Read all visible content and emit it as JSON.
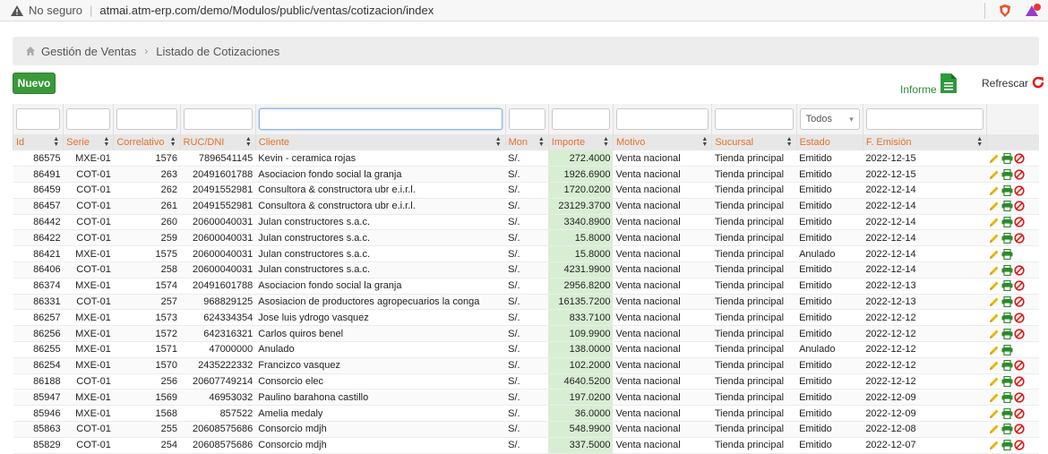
{
  "browser": {
    "security_label": "No seguro",
    "url": "atmai.atm-erp.com/demo/Modulos/public/ventas/cotizacion/index"
  },
  "breadcrumb": {
    "items": [
      "Gestión de Ventas",
      "Listado de Cotizaciones"
    ]
  },
  "toolbar": {
    "new_label": "Nuevo",
    "report_label": "Informe",
    "refresh_label": "Refrescar"
  },
  "filters": {
    "estado_selected": "Todos"
  },
  "columns": [
    "Id",
    "Serie",
    "Correlativo",
    "RUC/DNI",
    "Cliente",
    "Mon",
    "Importe",
    "Motivo",
    "Sucursal",
    "Estado",
    "F. Emisión"
  ],
  "rows": [
    {
      "id": "86575",
      "serie": "MXE-01",
      "correlativo": "1576",
      "ruc": "7896541145",
      "cliente": "Kevin - ceramica rojas",
      "mon": "S/.",
      "importe": "272.4000",
      "motivo": "Venta nacional",
      "sucursal": "Tienda principal",
      "estado": "Emitido",
      "fecha": "2022-12-15",
      "cancel": true
    },
    {
      "id": "86491",
      "serie": "COT-01",
      "correlativo": "263",
      "ruc": "20491601788",
      "cliente": "Asociacion fondo social la granja",
      "mon": "S/.",
      "importe": "1926.6900",
      "motivo": "Venta nacional",
      "sucursal": "Tienda principal",
      "estado": "Emitido",
      "fecha": "2022-12-15",
      "cancel": true
    },
    {
      "id": "86459",
      "serie": "COT-01",
      "correlativo": "262",
      "ruc": "20491552981",
      "cliente": "Consultora & constructora ubr e.i.r.l.",
      "mon": "S/.",
      "importe": "1720.0200",
      "motivo": "Venta nacional",
      "sucursal": "Tienda principal",
      "estado": "Emitido",
      "fecha": "2022-12-14",
      "cancel": true
    },
    {
      "id": "86457",
      "serie": "COT-01",
      "correlativo": "261",
      "ruc": "20491552981",
      "cliente": "Consultora & constructora ubr e.i.r.l.",
      "mon": "S/.",
      "importe": "23129.3700",
      "motivo": "Venta nacional",
      "sucursal": "Tienda principal",
      "estado": "Emitido",
      "fecha": "2022-12-14",
      "cancel": true
    },
    {
      "id": "86442",
      "serie": "COT-01",
      "correlativo": "260",
      "ruc": "20600040031",
      "cliente": "Julan constructores s.a.c.",
      "mon": "S/.",
      "importe": "3340.8900",
      "motivo": "Venta nacional",
      "sucursal": "Tienda principal",
      "estado": "Emitido",
      "fecha": "2022-12-14",
      "cancel": true
    },
    {
      "id": "86422",
      "serie": "COT-01",
      "correlativo": "259",
      "ruc": "20600040031",
      "cliente": "Julan constructores s.a.c.",
      "mon": "S/.",
      "importe": "15.8000",
      "motivo": "Venta nacional",
      "sucursal": "Tienda principal",
      "estado": "Emitido",
      "fecha": "2022-12-14",
      "cancel": true
    },
    {
      "id": "86421",
      "serie": "MXE-01",
      "correlativo": "1575",
      "ruc": "20600040031",
      "cliente": "Julan constructores s.a.c.",
      "mon": "S/.",
      "importe": "15.8000",
      "motivo": "Venta nacional",
      "sucursal": "Tienda principal",
      "estado": "Anulado",
      "fecha": "2022-12-14",
      "cancel": false
    },
    {
      "id": "86406",
      "serie": "COT-01",
      "correlativo": "258",
      "ruc": "20600040031",
      "cliente": "Julan constructores s.a.c.",
      "mon": "S/.",
      "importe": "4231.9900",
      "motivo": "Venta nacional",
      "sucursal": "Tienda principal",
      "estado": "Emitido",
      "fecha": "2022-12-14",
      "cancel": true
    },
    {
      "id": "86374",
      "serie": "MXE-01",
      "correlativo": "1574",
      "ruc": "20491601788",
      "cliente": "Asociacion fondo social la granja",
      "mon": "S/.",
      "importe": "2956.8200",
      "motivo": "Venta nacional",
      "sucursal": "Tienda principal",
      "estado": "Emitido",
      "fecha": "2022-12-13",
      "cancel": true
    },
    {
      "id": "86331",
      "serie": "COT-01",
      "correlativo": "257",
      "ruc": "968829125",
      "cliente": "Asosiacion de productores agropecuarios la conga",
      "mon": "S/.",
      "importe": "16135.7200",
      "motivo": "Venta nacional",
      "sucursal": "Tienda principal",
      "estado": "Emitido",
      "fecha": "2022-12-13",
      "cancel": true
    },
    {
      "id": "86257",
      "serie": "MXE-01",
      "correlativo": "1573",
      "ruc": "624334354",
      "cliente": "Jose luis ydrogo vasquez",
      "mon": "S/.",
      "importe": "833.7100",
      "motivo": "Venta nacional",
      "sucursal": "Tienda principal",
      "estado": "Emitido",
      "fecha": "2022-12-12",
      "cancel": true
    },
    {
      "id": "86256",
      "serie": "MXE-01",
      "correlativo": "1572",
      "ruc": "642316321",
      "cliente": "Carlos quiros benel",
      "mon": "S/.",
      "importe": "109.9900",
      "motivo": "Venta nacional",
      "sucursal": "Tienda principal",
      "estado": "Emitido",
      "fecha": "2022-12-12",
      "cancel": true
    },
    {
      "id": "86255",
      "serie": "MXE-01",
      "correlativo": "1571",
      "ruc": "47000000",
      "cliente": "Anulado",
      "mon": "S/.",
      "importe": "138.0000",
      "motivo": "Venta nacional",
      "sucursal": "Tienda principal",
      "estado": "Anulado",
      "fecha": "2022-12-12",
      "cancel": false
    },
    {
      "id": "86254",
      "serie": "MXE-01",
      "correlativo": "1570",
      "ruc": "2435222332",
      "cliente": "Francizco vasquez",
      "mon": "S/.",
      "importe": "102.2000",
      "motivo": "Venta nacional",
      "sucursal": "Tienda principal",
      "estado": "Emitido",
      "fecha": "2022-12-12",
      "cancel": true
    },
    {
      "id": "86188",
      "serie": "COT-01",
      "correlativo": "256",
      "ruc": "20607749214",
      "cliente": "Consorcio elec",
      "mon": "S/.",
      "importe": "4640.5200",
      "motivo": "Venta nacional",
      "sucursal": "Tienda principal",
      "estado": "Emitido",
      "fecha": "2022-12-12",
      "cancel": true
    },
    {
      "id": "85947",
      "serie": "MXE-01",
      "correlativo": "1569",
      "ruc": "46953032",
      "cliente": "Paulino barahona castillo",
      "mon": "S/.",
      "importe": "197.0200",
      "motivo": "Venta nacional",
      "sucursal": "Tienda principal",
      "estado": "Emitido",
      "fecha": "2022-12-09",
      "cancel": true
    },
    {
      "id": "85946",
      "serie": "MXE-01",
      "correlativo": "1568",
      "ruc": "857522",
      "cliente": "Amelia medaly",
      "mon": "S/.",
      "importe": "36.0000",
      "motivo": "Venta nacional",
      "sucursal": "Tienda principal",
      "estado": "Emitido",
      "fecha": "2022-12-09",
      "cancel": true
    },
    {
      "id": "85863",
      "serie": "COT-01",
      "correlativo": "255",
      "ruc": "20608575686",
      "cliente": "Consorcio mdjh",
      "mon": "S/.",
      "importe": "548.9900",
      "motivo": "Venta nacional",
      "sucursal": "Tienda principal",
      "estado": "Emitido",
      "fecha": "2022-12-08",
      "cancel": true
    },
    {
      "id": "85829",
      "serie": "COT-01",
      "correlativo": "254",
      "ruc": "20608575686",
      "cliente": "Consorcio mdjh",
      "mon": "S/.",
      "importe": "337.5000",
      "motivo": "Venta nacional",
      "sucursal": "Tienda principal",
      "estado": "Emitido",
      "fecha": "2022-12-07",
      "cancel": true
    }
  ]
}
